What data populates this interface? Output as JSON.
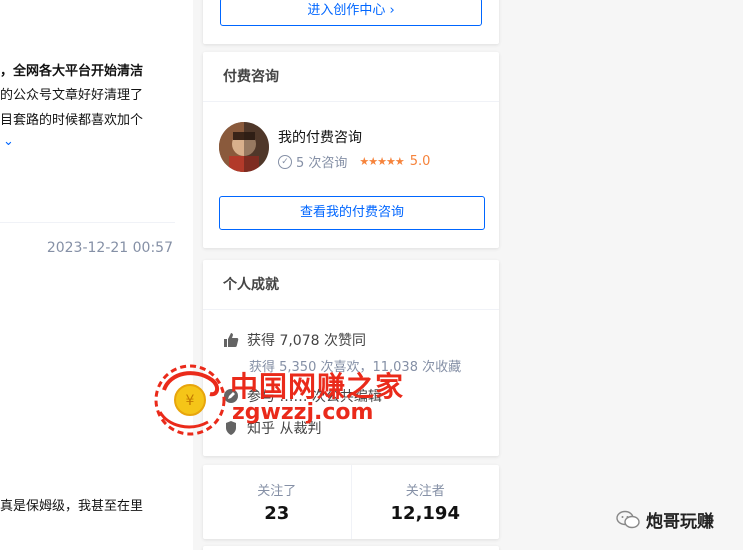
{
  "feed": {
    "headline_fragment": "，全网各大平台开始清洁",
    "body_line_1": "的公众号文章好好清理了",
    "body_line_2": "目套路的时候都喜欢加个",
    "expand_chevron": "⌄",
    "timestamp": "2023-12-21 00:57",
    "bottom_line": "真是保姆级，我甚至在里"
  },
  "creator_card": {
    "button_label": "进入创作中心 ›"
  },
  "consult_card": {
    "title": "付费咨询",
    "name": "我的付费咨询",
    "count": "5 次咨询",
    "stars": "★★★★★",
    "rating": "5.0",
    "view_button": "查看我的付费咨询"
  },
  "achievement_card": {
    "title": "个人成就",
    "likes": "获得 7,078 次赞同",
    "sub_stats": "获得 5,350 次喜欢，11,038 次收藏",
    "row_3": "参与 …… 次公共编辑",
    "row_4": "知乎 从裁判"
  },
  "follow_card": {
    "following_label": "关注了",
    "following_count": "23",
    "followers_label": "关注者",
    "followers_count": "12,194"
  },
  "watermark": {
    "title": "中国网赚之家",
    "url": "zgwzzj.com"
  },
  "wechat_tag": {
    "label": "炮哥玩赚"
  },
  "icons": {
    "thumb": "thumbs-up-icon",
    "edit": "edit-icon",
    "judge": "judge-icon",
    "check": "check-circle-icon",
    "wechat": "wechat-icon"
  },
  "colors": {
    "accent": "#0066ff",
    "star": "#f6833b",
    "watermark": "#ea2a1a"
  }
}
